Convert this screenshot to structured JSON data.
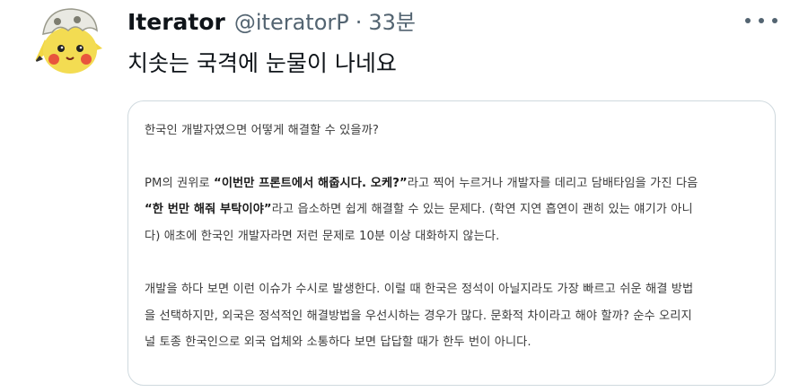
{
  "author": {
    "name": "Iterator",
    "handle": "@iteratorP",
    "separator": "·",
    "time": "33분"
  },
  "tweet": {
    "text": "치솟는 국격에 눈물이 나네요"
  },
  "card": {
    "question": "한국인 개발자였으면 어떻게 해결할 수 있을까?",
    "p1": {
      "l1_a": "PM의 권위로 ",
      "l1_b": "“이번만 프론트에서 해줍시다. 오케?”",
      "l1_c": "라고 찍어 누르거나 개발자를 데리고 담배타임을 가진 다음",
      "l2_a": "“한 번만 해줘 부탁이야”",
      "l2_b": "라고 읍소하면 쉽게 해결할 수 있는 문제다. (학연 지연 흡연이 괜히 있는 얘기가 아니",
      "l3": "다) 애초에 한국인 개발자라면 저런 문제로 10분 이상 대화하지 않는다."
    },
    "p2": {
      "l1": "개발을 하다 보면 이런 이슈가 수시로 발생한다. 이럴 때 한국은 정석이 아닐지라도 가장 빠르고 쉬운 해결 방법",
      "l2": "을 선택하지만, 외국은 정석적인 해결방법을 우선시하는 경우가 많다. 문화적 차이라고 해야 할까? 순수 오리지",
      "l3": "널 토종 한국인으로 외국 업체와 소통하다 보면 답답할 때가 한두 번이 아니다."
    }
  },
  "icons": {
    "more": "more-horizontal-icon",
    "avatar": "pikachu-avatar"
  },
  "colors": {
    "text": "#0f1419",
    "secondary": "#536471",
    "border": "#cfd9de"
  }
}
